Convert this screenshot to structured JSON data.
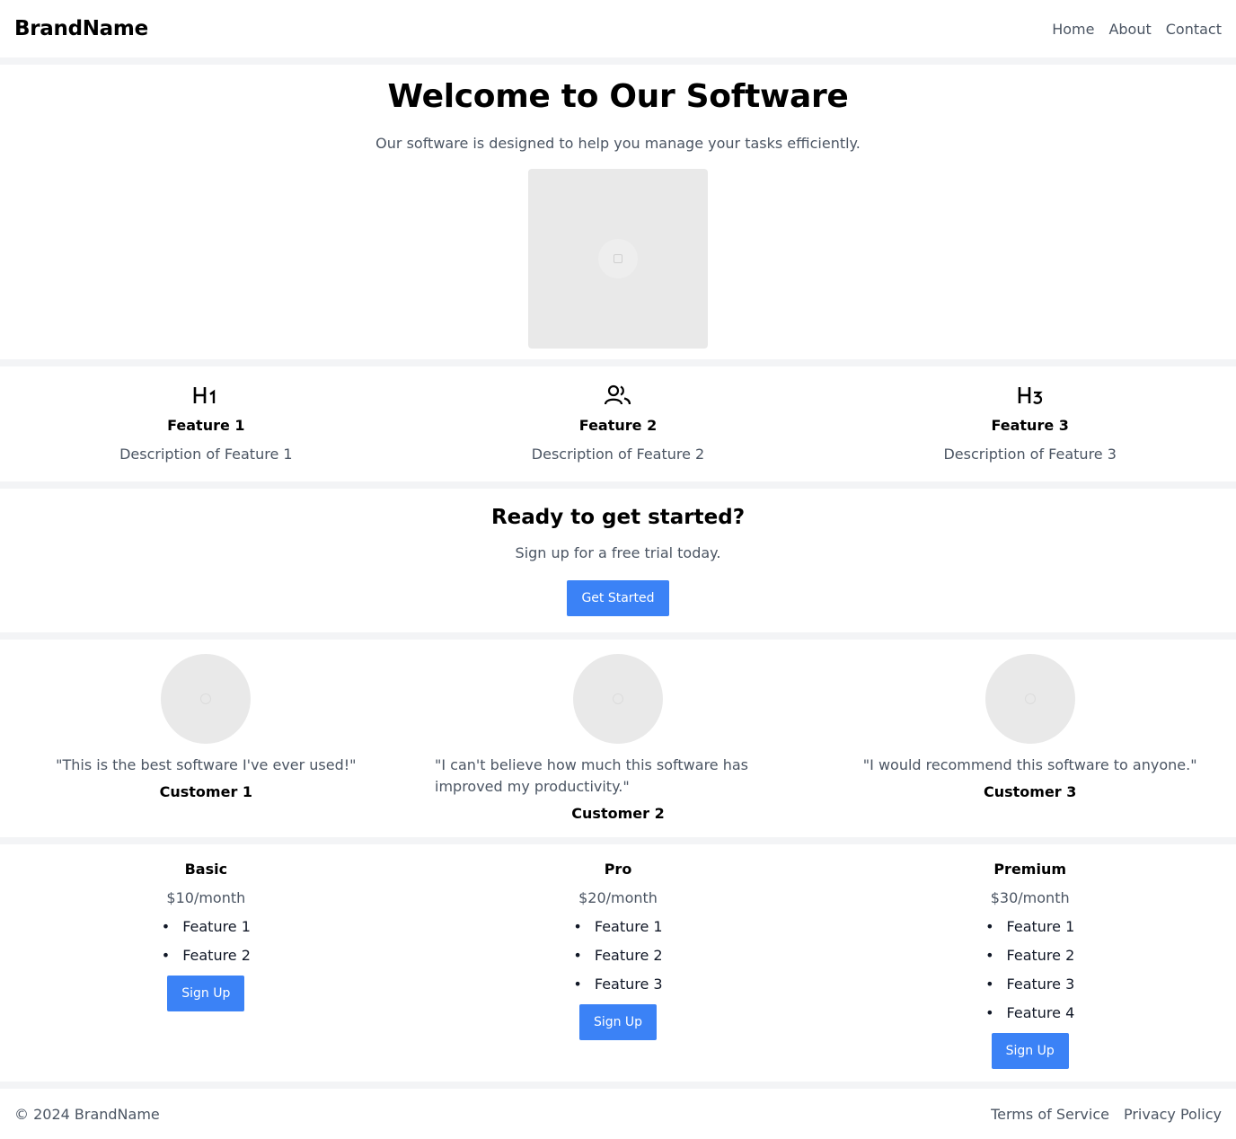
{
  "header": {
    "brand": "BrandName",
    "nav": [
      "Home",
      "About",
      "Contact"
    ]
  },
  "hero": {
    "title": "Welcome to Our Software",
    "subtitle": "Our software is designed to help you manage your tasks efficiently.",
    "image_icon": "image-placeholder-icon"
  },
  "features": [
    {
      "icon": "heading-1-icon",
      "glyph": "H1",
      "title": "Feature 1",
      "description": "Description of Feature 1"
    },
    {
      "icon": "users-icon",
      "glyph": "",
      "title": "Feature 2",
      "description": "Description of Feature 2"
    },
    {
      "icon": "heading-3-icon",
      "glyph": "H3",
      "title": "Feature 3",
      "description": "Description of Feature 3"
    }
  ],
  "cta": {
    "title": "Ready to get started?",
    "text": "Sign up for a free trial today.",
    "button": "Get Started"
  },
  "testimonials": [
    {
      "quote": "\"This is the best software I've ever used!\"",
      "name": "Customer 1"
    },
    {
      "quote": "\"I can't believe how much this software has improved my productivity.\"",
      "name": "Customer 2"
    },
    {
      "quote": "\"I would recommend this software to anyone.\"",
      "name": "Customer 3"
    }
  ],
  "pricing": [
    {
      "name": "Basic",
      "price": "$10/month",
      "features": [
        "Feature 1",
        "Feature 2"
      ],
      "button": "Sign Up"
    },
    {
      "name": "Pro",
      "price": "$20/month",
      "features": [
        "Feature 1",
        "Feature 2",
        "Feature 3"
      ],
      "button": "Sign Up"
    },
    {
      "name": "Premium",
      "price": "$30/month",
      "features": [
        "Feature 1",
        "Feature 2",
        "Feature 3",
        "Feature 4"
      ],
      "button": "Sign Up"
    }
  ],
  "footer": {
    "copyright": "© 2024 BrandName",
    "links": [
      "Terms of Service",
      "Privacy Policy"
    ]
  },
  "colors": {
    "accent": "#3b82f6",
    "page_background": "#f3f4f6",
    "muted_text": "#4b5563"
  }
}
